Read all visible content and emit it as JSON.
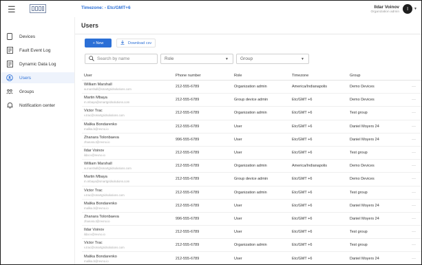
{
  "topbar": {
    "timezone": "Timezone: - Etc/GMT+6",
    "user_name": "Ildar Voinov",
    "user_role": "Organization admin",
    "avatar_letter": "I"
  },
  "sidebar": {
    "items": [
      {
        "label": "Devices",
        "icon": "device-icon"
      },
      {
        "label": "Fault Event Log",
        "icon": "log-icon"
      },
      {
        "label": "Dynamic Data Log",
        "icon": "log-icon"
      },
      {
        "label": "Users",
        "icon": "users-icon",
        "active": true
      },
      {
        "label": "Groups",
        "icon": "groups-icon"
      },
      {
        "label": "Notification center",
        "icon": "bell-icon"
      }
    ]
  },
  "main": {
    "title": "Users",
    "new_label": "+  New",
    "download_label": "Download csv",
    "search_placeholder": "Search by name",
    "role_placeholder": "Role",
    "group_placeholder": "Group"
  },
  "table": {
    "headers": [
      "User",
      "Phone number",
      "Role",
      "Timezone",
      "Group"
    ],
    "more": "···",
    "rows": [
      {
        "name": "William Marshall",
        "email": "w.marshall@smartgridsolutions.com",
        "phone": "212-555-6789",
        "role": "Organization admin",
        "tz": "America/Indianapolis",
        "group": "Demo Devices"
      },
      {
        "name": "Martin Mbaya",
        "email": "m.mbaya@smartgridsolutions.com",
        "phone": "212-555-6789",
        "role": "Group device admin",
        "tz": "Etc/GMT +6",
        "group": "Demo Devices"
      },
      {
        "name": "Victor Trac",
        "email": "v.trac@smartgridsolutions.com",
        "phone": "212-555-6789",
        "role": "Organization admin",
        "tz": "Etc/GMT +6",
        "group": "Test group"
      },
      {
        "name": "Malika Bondarenko",
        "email": "malika.b@revno.io",
        "phone": "212-555-6789",
        "role": "User",
        "tz": "Etc/GMT +6",
        "group": "Daniel Moyers 24"
      },
      {
        "name": "Zhanara Tolonbaeva",
        "email": "zhanara.t@revno.io",
        "phone": "996-555-6789",
        "role": "User",
        "tz": "Etc/GMT +6",
        "group": "Daniel Moyers 24"
      },
      {
        "name": "Ildar Voinov",
        "email": "ildar.v@revno.io",
        "phone": "212-555-6789",
        "role": "User",
        "tz": "Etc/GMT +6",
        "group": "Test group"
      },
      {
        "name": "William Marshall",
        "email": "w.marshall@smartgridsolutions.com",
        "phone": "212-555-6789",
        "role": "Organization admin",
        "tz": "America/Indianapolis",
        "group": "Demo Devices"
      },
      {
        "name": "Martin Mbaya",
        "email": "m.mbaya@smartgridsolutions.com",
        "phone": "212-555-6789",
        "role": "Group device admin",
        "tz": "Etc/GMT +6",
        "group": "Demo Devices"
      },
      {
        "name": "Victor Trac",
        "email": "v.trac@smartgridsolutions.com",
        "phone": "212-555-6789",
        "role": "Organization admin",
        "tz": "Etc/GMT +6",
        "group": "Test group"
      },
      {
        "name": "Malika Bondarenko",
        "email": "malika.b@revno.io",
        "phone": "212-555-6789",
        "role": "User",
        "tz": "Etc/GMT +6",
        "group": "Daniel Moyers 24"
      },
      {
        "name": "Zhanara Tolonbaeva",
        "email": "zhanara.t@revno.io",
        "phone": "996-555-6789",
        "role": "User",
        "tz": "Etc/GMT +6",
        "group": "Daniel Moyers 24"
      },
      {
        "name": "Ildar Voinov",
        "email": "ildar.v@revno.io",
        "phone": "212-555-6789",
        "role": "User",
        "tz": "Etc/GMT +6",
        "group": "Test group"
      },
      {
        "name": "Victor Trac",
        "email": "v.trac@smartgridsolutions.com",
        "phone": "212-555-6789",
        "role": "Organization admin",
        "tz": "Etc/GMT +6",
        "group": "Test group"
      },
      {
        "name": "Malika Bondarenko",
        "email": "malika.b@revno.io",
        "phone": "212-555-6789",
        "role": "User",
        "tz": "Etc/GMT +6",
        "group": "Daniel Moyers 24"
      }
    ]
  },
  "colors": {
    "accent": "#2b6fd6",
    "active_bg": "#eef3fc"
  }
}
